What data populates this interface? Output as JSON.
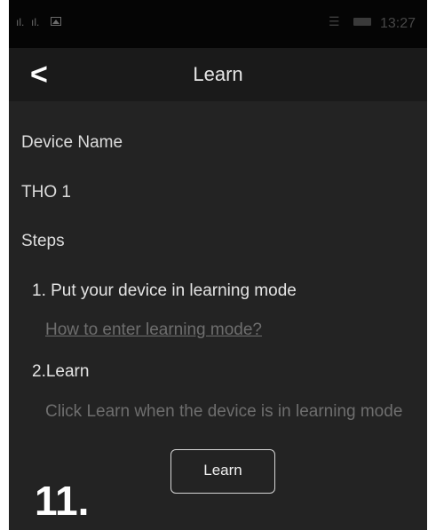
{
  "status_bar": {
    "signal_1": "ıl.",
    "signal_2": "ıl.",
    "image_icon": "image-icon",
    "wifi_icon": "wifi-icon",
    "battery_icon": "battery-icon",
    "time": "13:27"
  },
  "header": {
    "back_icon": "chevron-left-icon",
    "back_glyph": "<",
    "title": "Learn"
  },
  "form": {
    "device_name_label": "Device Name",
    "device_name_value": "THO 1",
    "steps_label": "Steps",
    "step1": "1. Put your device in learning mode",
    "help_link": "How to enter learning mode?",
    "step2": "2.Learn",
    "step2_description": "Click Learn when the device is in learning mode",
    "learn_button": "Learn"
  },
  "step_number": "11.",
  "colors": {
    "background": "#232323",
    "header_bg": "#1a1a1a",
    "status_bg": "#050505",
    "primary_text": "#e4e4e4",
    "secondary_text": "#6e6e6e"
  }
}
